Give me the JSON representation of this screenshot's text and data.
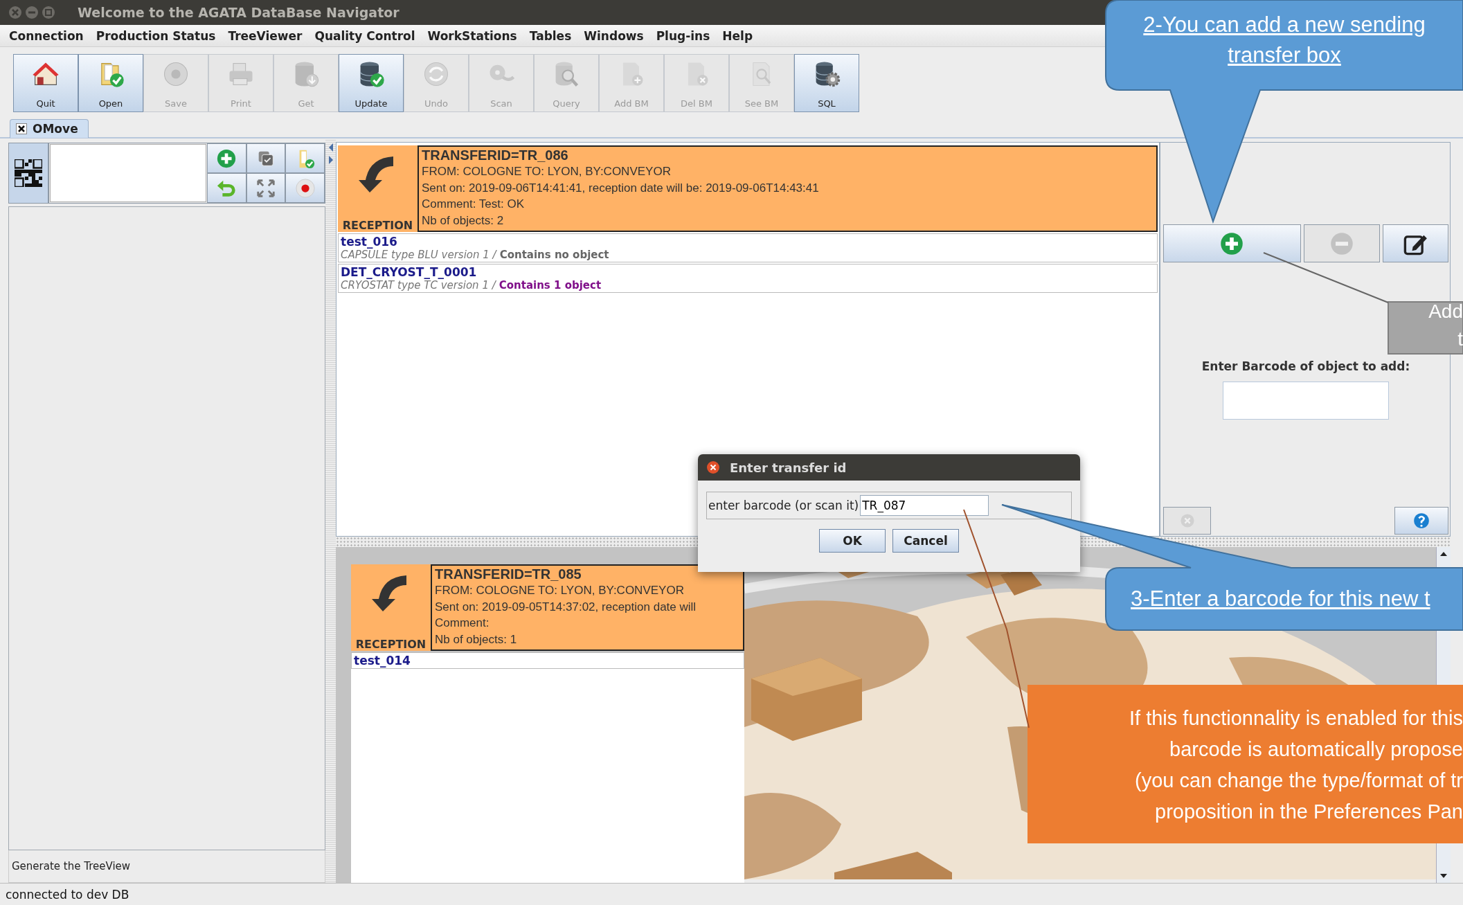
{
  "window": {
    "title": "Welcome to the AGATA DataBase Navigator"
  },
  "menu": [
    "Connection",
    "Production Status",
    "TreeViewer",
    "Quality Control",
    "WorkStations",
    "Tables",
    "Windows",
    "Plug-ins",
    "Help"
  ],
  "toolbar": [
    {
      "label": "Quit",
      "disabled": false
    },
    {
      "label": "Open",
      "disabled": false
    },
    {
      "label": "Save",
      "disabled": true
    },
    {
      "label": "Print",
      "disabled": true
    },
    {
      "label": "Get",
      "disabled": true
    },
    {
      "label": "Update",
      "disabled": false
    },
    {
      "label": "Undo",
      "disabled": true
    },
    {
      "label": "Scan",
      "disabled": true
    },
    {
      "label": "Query",
      "disabled": true
    },
    {
      "label": "Add BM",
      "disabled": true
    },
    {
      "label": "Del BM",
      "disabled": true
    },
    {
      "label": "See BM",
      "disabled": true
    },
    {
      "label": "SQL",
      "disabled": false
    }
  ],
  "tabs": [
    {
      "label": "OMove",
      "selected": true
    }
  ],
  "left_panel": {
    "status": "Generate the TreeView"
  },
  "transfers": [
    {
      "direction": "RECEPTION",
      "title": "TRANSFERID=TR_086",
      "lines": [
        "FROM: COLOGNE TO: LYON, BY:CONVEYOR",
        "Sent on: 2019-09-06T14:41:41, reception date will be: 2019-09-06T14:43:41",
        "Comment: Test: OK",
        "Nb of objects: 2"
      ],
      "objects": [
        {
          "name": "test_016",
          "description": "CAPSULE type BLU version 1 /",
          "contents": "Contains no object",
          "has_objects": false
        },
        {
          "name": "DET_CRYOST_T_0001",
          "description": "CRYOSTAT type TC version 1 /",
          "contents": "Contains 1 object",
          "has_objects": true
        }
      ]
    },
    {
      "direction": "RECEPTION",
      "title": "TRANSFERID=TR_085",
      "lines": [
        "FROM: COLOGNE TO: LYON, BY:CONVEYOR",
        "Sent on: 2019-09-05T14:37:02, reception date will",
        "Comment:",
        "Nb of objects: 1"
      ],
      "objects": [
        {
          "name": "test_014"
        }
      ]
    }
  ],
  "object_panel": {
    "buttons": [
      {
        "disabled": false
      },
      {
        "disabled": true
      },
      {
        "disabled": false
      }
    ],
    "label": "Enter Barcode of object to add:",
    "footer_buttons": [
      {
        "disabled": true
      },
      {
        "disabled": false
      }
    ]
  },
  "dialog": {
    "title": "Enter transfer id",
    "label": "enter barcode (or scan it)",
    "value": "TR_087",
    "buttons": [
      "OK",
      "Cancel"
    ]
  },
  "callouts": [
    {
      "kind": "blue",
      "text": "2-You can add a new sending transfer box"
    },
    {
      "kind": "gray",
      "lines": [
        "Add",
        "t"
      ]
    },
    {
      "kind": "blue",
      "text": "3-Enter a barcode for this new t"
    },
    {
      "kind": "orange",
      "lines": [
        "If this functionnality is enabled for this",
        "barcode is automatically propose",
        "(you can change the type/format of tr",
        "proposition in the Preferences Pan"
      ]
    }
  ],
  "status_bar": "connected to dev DB"
}
